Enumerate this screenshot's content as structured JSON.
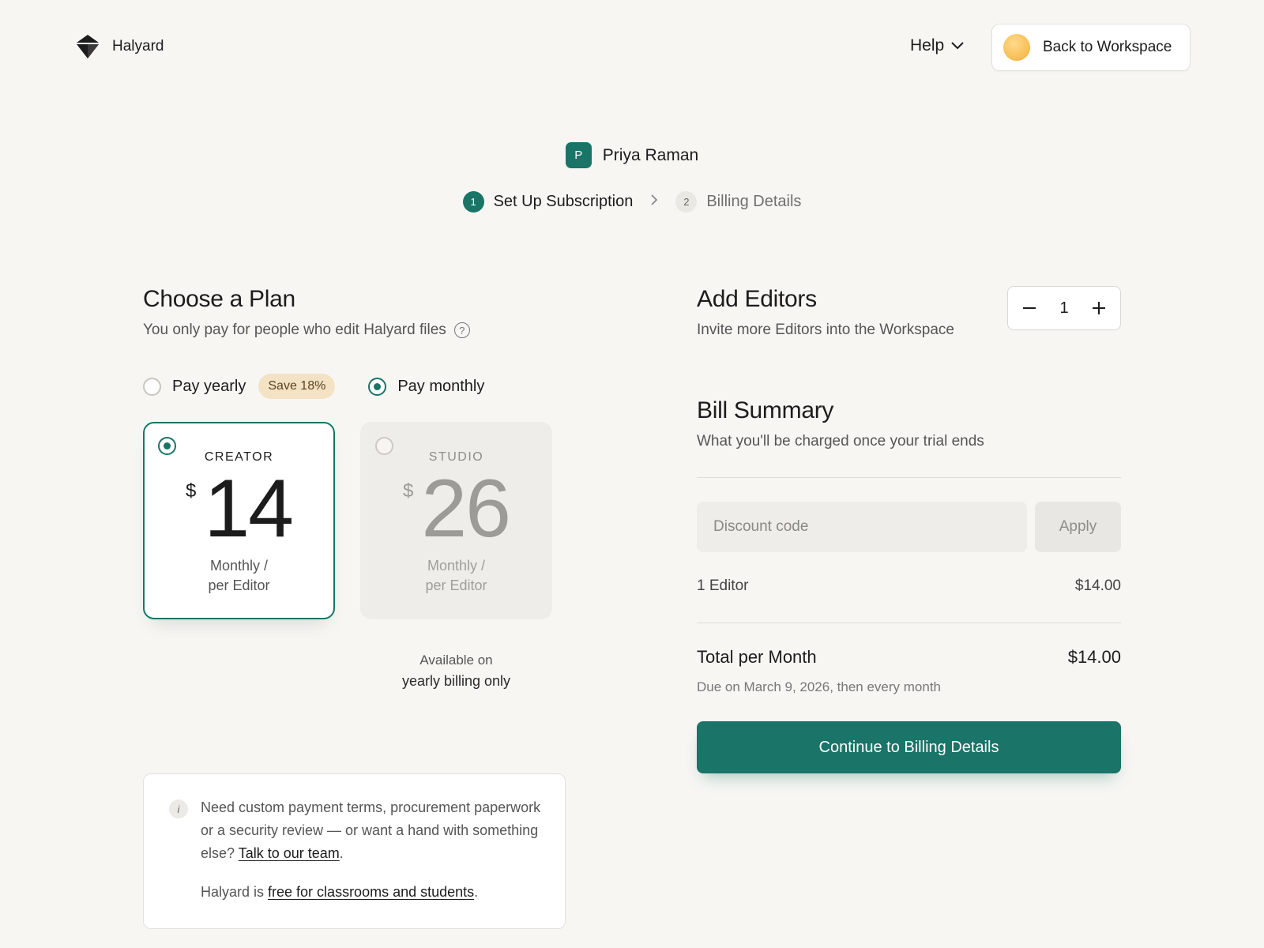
{
  "header": {
    "brand": "Halyard",
    "help_label": "Help",
    "back_label": "Back to Workspace"
  },
  "user": {
    "initial": "P",
    "name": "Priya Raman"
  },
  "steps": [
    {
      "num": "1",
      "label": "Set Up Subscription",
      "active": true
    },
    {
      "num": "2",
      "label": "Billing Details",
      "active": false
    }
  ],
  "plan": {
    "title": "Choose a Plan",
    "subtitle": "You only pay for people who edit Halyard files",
    "help_glyph": "?",
    "billing_options": {
      "yearly": "Pay yearly",
      "save_badge": "Save 18%",
      "monthly": "Pay monthly",
      "selected": "monthly"
    },
    "cards": [
      {
        "name": "CREATOR",
        "currency": "$",
        "amount": "14",
        "period_line1": "Monthly /",
        "period_line2": "per Editor",
        "selected": true
      },
      {
        "name": "STUDIO",
        "currency": "$",
        "amount": "26",
        "period_line1": "Monthly /",
        "period_line2": "per Editor",
        "selected": false
      }
    ],
    "availability_line1": "Available on",
    "availability_line2": "yearly billing only"
  },
  "info": {
    "icon_glyph": "i",
    "p1_text": "Need custom payment terms, procurement paperwork or a security review — or want a hand with something else? ",
    "p1_link": "Talk to our team",
    "p1_end": ".",
    "p2_text": "Halyard is ",
    "p2_link": "free for classrooms and students",
    "p2_end": "."
  },
  "editors": {
    "title": "Add Editors",
    "subtitle": "Invite more Editors into the Workspace",
    "count": "1"
  },
  "bill": {
    "title": "Bill Summary",
    "subtitle": "What you'll be charged once your trial ends",
    "discount_placeholder": "Discount code",
    "discount_value": "",
    "apply_label": "Apply",
    "line_label": "1 Editor",
    "line_amount": "$14.00",
    "total_label": "Total per Month",
    "total_amount": "$14.00",
    "due_text": "Due on March 9, 2026, then every month",
    "continue_label": "Continue to Billing Details"
  },
  "colors": {
    "accent": "#1a7468",
    "background": "#f7f6f3",
    "badge": "#f3e3c4"
  },
  "icons": {
    "logo": "diamond-logo-icon",
    "help": "chevron-down-icon",
    "back": "workspace-avatar-icon",
    "step_sep": "chevron-right-icon",
    "minus": "minus-icon",
    "plus": "plus-icon",
    "info": "info-icon",
    "help_circle": "question-circle-icon"
  }
}
